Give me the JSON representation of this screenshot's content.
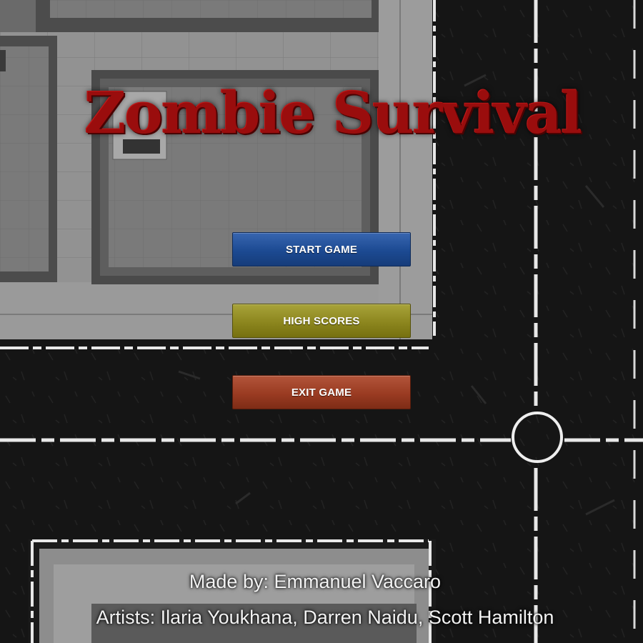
{
  "title": "Zombie Survival",
  "menu": {
    "start_label": "START GAME",
    "scores_label": "HIGH SCORES",
    "exit_label": "EXIT GAME"
  },
  "credits": {
    "made_by": "Made by: Emmanuel Vaccaro",
    "artists": "Artists: Ilaria Youkhana, Darren Naidu, Scott Hamilton"
  },
  "colors": {
    "title": "#9a0d0d",
    "start_button": "#1c4a92",
    "scores_button": "#8c861e",
    "exit_button": "#9a3b22",
    "road": "#141414",
    "sidewalk": "#8a8a8a"
  }
}
